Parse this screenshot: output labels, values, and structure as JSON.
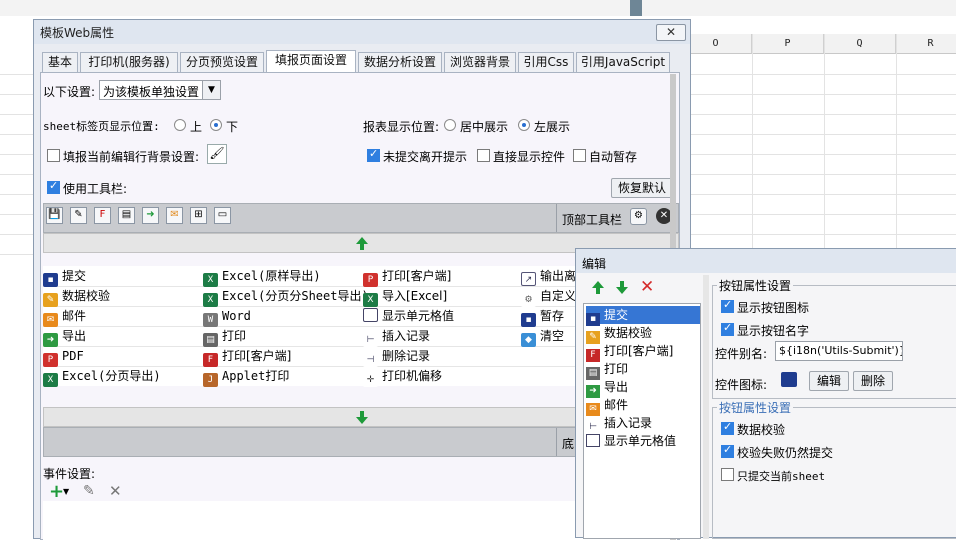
{
  "spreadsheet": {
    "columns": [
      "O",
      "P",
      "Q",
      "R"
    ]
  },
  "dialog": {
    "title": "模板Web属性",
    "close": "✕",
    "tabs": [
      "基本",
      "打印机(服务器)",
      "分页预览设置",
      "填报页面设置",
      "数据分析设置",
      "浏览器背景",
      "引用Css",
      "引用JavaScript"
    ],
    "active_tab": "填报页面设置",
    "settings_label": "以下设置:",
    "settings_value": "为该模板单独设置",
    "sheet_pos_label": "sheet标签页显示位置:",
    "sheet_pos_options": [
      "上",
      "下"
    ],
    "sheet_pos_selected": "下",
    "report_pos_label": "报表显示位置:",
    "report_pos_options": [
      "居中展示",
      "左展示"
    ],
    "report_pos_selected": "左展示",
    "fill_bg_label": "填报当前编辑行背景设置:",
    "fill_bg_checked": false,
    "unsubmitted_label": "未提交离开提示",
    "unsubmitted_checked": true,
    "direct_show_label": "直接显示控件",
    "direct_show_checked": false,
    "autosave_label": "自动暂存",
    "autosave_checked": false,
    "use_toolbar_label": "使用工具栏:",
    "use_toolbar_checked": true,
    "restore_default": "恢复默认",
    "top_toolbar_label": "顶部工具栏",
    "bottom_toolbar_label": "底",
    "buttons_grid": [
      [
        "提交",
        "Excel(原样导出)",
        "打印[客户端]",
        "输出离"
      ],
      [
        "数据校验",
        "Excel(分页分Sheet导出)",
        "导入[Excel]",
        "自定义"
      ],
      [
        "邮件",
        "Word",
        "显示单元格值",
        "暂存"
      ],
      [
        "导出",
        "打印",
        "插入记录",
        "清空"
      ],
      [
        "PDF",
        "打印[客户端]",
        "删除记录",
        ""
      ],
      [
        "Excel(分页导出)",
        "Applet打印",
        "打印机偏移",
        ""
      ]
    ],
    "event_label": "事件设置:"
  },
  "edit_dialog": {
    "title": "编辑",
    "list_items": [
      "提交",
      "数据校验",
      "打印[客户端]",
      "打印",
      "导出",
      "邮件",
      "插入记录",
      "显示单元格值"
    ],
    "selected_item": "提交",
    "group1_title": "按钮属性设置",
    "show_icon_label": "显示按钮图标",
    "show_icon_checked": true,
    "show_name_label": "显示按钮名字",
    "show_name_checked": true,
    "alias_label": "控件别名:",
    "alias_value": "${i18n('Utils-Submit')}",
    "icon_label": "控件图标:",
    "edit_button": "编辑",
    "delete_button": "删除",
    "group2_title": "按钮属性设置",
    "data_check_label": "数据校验",
    "data_check_checked": true,
    "fail_submit_label": "校验失败仍然提交",
    "fail_submit_checked": true,
    "only_sheet_label": "只提交当前sheet",
    "only_sheet_checked": false
  }
}
